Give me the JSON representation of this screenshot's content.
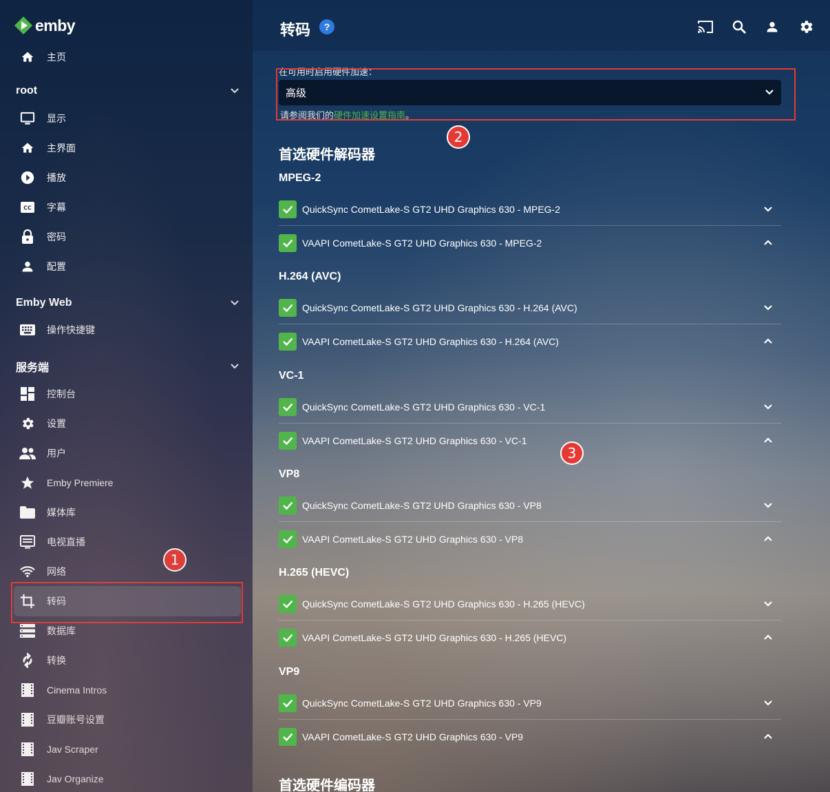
{
  "app": {
    "logo_text": "emby"
  },
  "sidebar": {
    "home": "主页",
    "sections": [
      {
        "title": "root",
        "items": [
          {
            "label": "显示",
            "icon": "monitor-icon"
          },
          {
            "label": "主界面",
            "icon": "home-icon"
          },
          {
            "label": "播放",
            "icon": "play-circle-icon"
          },
          {
            "label": "字幕",
            "icon": "closed-caption-icon"
          },
          {
            "label": "密码",
            "icon": "lock-icon"
          },
          {
            "label": "配置",
            "icon": "person-icon"
          }
        ]
      },
      {
        "title": "Emby Web",
        "items": [
          {
            "label": "操作快捷键",
            "icon": "keyboard-icon"
          }
        ]
      },
      {
        "title": "服务端",
        "items": [
          {
            "label": "控制台",
            "icon": "dashboard-icon"
          },
          {
            "label": "设置",
            "icon": "gear-icon"
          },
          {
            "label": "用户",
            "icon": "people-icon"
          },
          {
            "label": "Emby Premiere",
            "icon": "star-icon"
          },
          {
            "label": "媒体库",
            "icon": "folder-icon"
          },
          {
            "label": "电视直播",
            "icon": "tv-guide-icon"
          },
          {
            "label": "网络",
            "icon": "wifi-icon"
          },
          {
            "label": "转码",
            "icon": "crop-icon",
            "active": true
          },
          {
            "label": "数据库",
            "icon": "database-icon"
          },
          {
            "label": "转换",
            "icon": "sync-icon"
          },
          {
            "label": "Cinema Intros",
            "icon": "plugin-icon"
          },
          {
            "label": "豆瓣账号设置",
            "icon": "plugin-icon"
          },
          {
            "label": "Jav Scraper",
            "icon": "plugin-icon"
          },
          {
            "label": "Jav Organize",
            "icon": "plugin-icon"
          }
        ]
      }
    ]
  },
  "header": {
    "title": "转码",
    "help": "?"
  },
  "hw_accel": {
    "label": "在可用时启用硬件加速：",
    "value": "高级",
    "hint_prefix": "请参阅我们的",
    "hint_link": "硬件加速设置指南",
    "hint_suffix": "。"
  },
  "decoders": {
    "title": "首选硬件解码器",
    "groups": [
      {
        "name": "MPEG-2",
        "items": [
          "QuickSync CometLake-S GT2 UHD Graphics 630 - MPEG-2",
          "VAAPI CometLake-S GT2 UHD Graphics 630 - MPEG-2"
        ]
      },
      {
        "name": "H.264 (AVC)",
        "items": [
          "QuickSync CometLake-S GT2 UHD Graphics 630 - H.264 (AVC)",
          "VAAPI CometLake-S GT2 UHD Graphics 630 - H.264 (AVC)"
        ]
      },
      {
        "name": "VC-1",
        "items": [
          "QuickSync CometLake-S GT2 UHD Graphics 630 - VC-1",
          "VAAPI CometLake-S GT2 UHD Graphics 630 - VC-1"
        ]
      },
      {
        "name": "VP8",
        "items": [
          "QuickSync CometLake-S GT2 UHD Graphics 630 - VP8",
          "VAAPI CometLake-S GT2 UHD Graphics 630 - VP8"
        ]
      },
      {
        "name": "H.265 (HEVC)",
        "items": [
          "QuickSync CometLake-S GT2 UHD Graphics 630 - H.265 (HEVC)",
          "VAAPI CometLake-S GT2 UHD Graphics 630 - H.265 (HEVC)"
        ]
      },
      {
        "name": "VP9",
        "items": [
          "QuickSync CometLake-S GT2 UHD Graphics 630 - VP9",
          "VAAPI CometLake-S GT2 UHD Graphics 630 - VP9"
        ]
      }
    ]
  },
  "encoders": {
    "title": "首选硬件编码器"
  },
  "annotations": [
    "1",
    "2",
    "3"
  ],
  "colors": {
    "accent_green": "#52b54b",
    "annotation_red": "#e53935",
    "help_blue": "#2f7be0"
  }
}
